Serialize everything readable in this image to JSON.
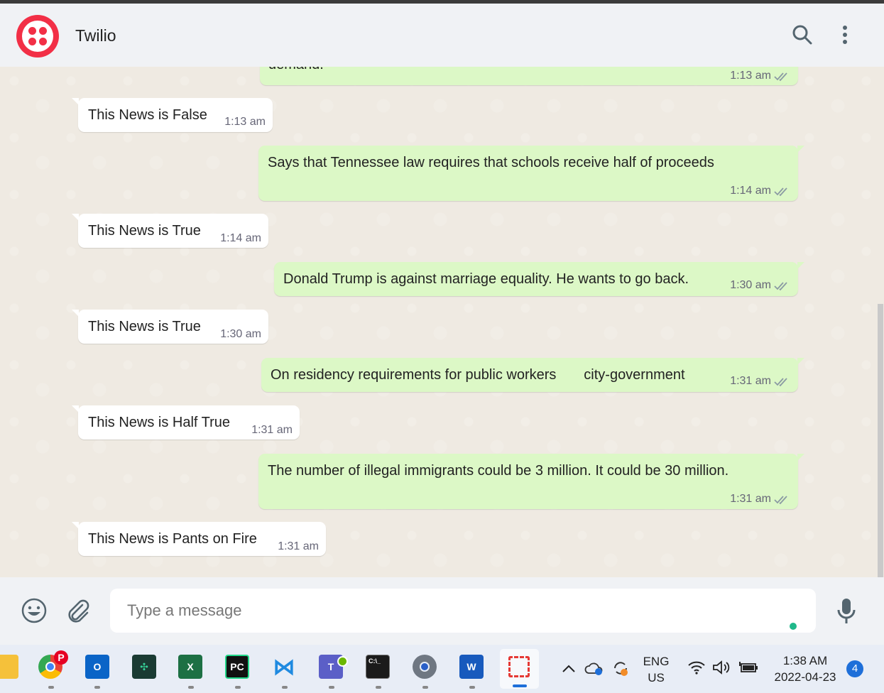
{
  "header": {
    "title": "Twilio",
    "logo_icon": "twilio-logo-icon",
    "search_icon": "search-icon",
    "menu_icon": "kebab-menu-icon"
  },
  "chat": {
    "partial_top": {
      "text": "demand.",
      "time": "1:13 am"
    },
    "messages": [
      {
        "dir": "in",
        "text": "This News is False",
        "time": "1:13 am"
      },
      {
        "dir": "out",
        "text": "Says that Tennessee law requires that schools receive half of proceeds",
        "time": "1:14 am"
      },
      {
        "dir": "in",
        "text": "This News is True",
        "time": "1:14 am"
      },
      {
        "dir": "out",
        "text": "Donald Trump is against marriage equality. He wants to go back.",
        "time": "1:30 am"
      },
      {
        "dir": "in",
        "text": "This News is True",
        "time": "1:30 am"
      },
      {
        "dir": "out",
        "text": "On residency requirements for public workers       city-government",
        "time": "1:31 am"
      },
      {
        "dir": "in",
        "text": "This News is Half True",
        "time": "1:31 am"
      },
      {
        "dir": "out",
        "text": "The number of illegal immigrants could be 3 million. It could be 30 million.",
        "time": "1:31 am"
      },
      {
        "dir": "in",
        "text": "This News is Pants on Fire",
        "time": "1:31 am"
      }
    ]
  },
  "composer": {
    "placeholder": "Type a message",
    "emoji_icon": "emoji-icon",
    "attach_icon": "paperclip-icon",
    "mic_icon": "microphone-icon"
  },
  "taskbar": {
    "apps": [
      "file-explorer",
      "chrome",
      "outlook",
      "app-green",
      "excel",
      "pycharm",
      "vscode",
      "teams",
      "terminal",
      "settings",
      "word",
      "snipping-tool"
    ],
    "tray": {
      "language_top": "ENG",
      "language_bottom": "US",
      "time": "1:38 AM",
      "date": "2022-04-23",
      "notification_count": "4"
    }
  },
  "colors": {
    "brand": "#f22f46",
    "outgoing_bubble": "#dcf8c6",
    "incoming_bubble": "#ffffff",
    "read_ticks": "#53bdeb"
  }
}
